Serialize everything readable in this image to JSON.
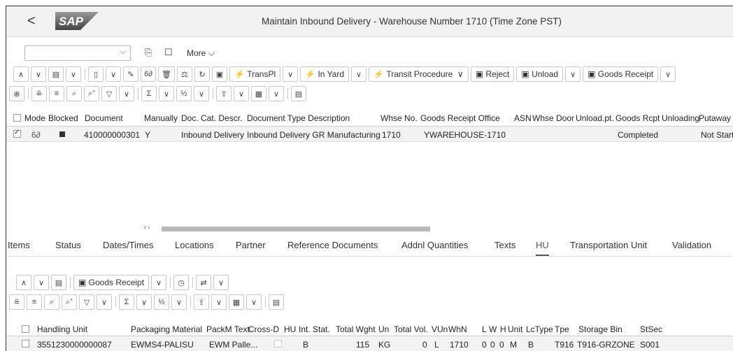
{
  "header": {
    "back_glyph": "<",
    "logo_text": "SAP",
    "title": "Maintain Inbound Delivery - Warehouse Number 1710 (Time Zone PST)"
  },
  "toolbar": {
    "command_value": "",
    "more_label": "More",
    "buttons": {
      "transpl": "TransPl",
      "in_yard": "In Yard",
      "transit_procedure": "Transit Procedure",
      "reject": "Reject",
      "unload": "Unload",
      "goods_receipt": "Goods Receipt"
    }
  },
  "top_grid": {
    "columns": [
      "Mode",
      "Blocked",
      "Document",
      "Manually",
      "Doc. Cat. Descr.",
      "Document Type Description",
      "Whse No.",
      "Goods Receipt Office",
      "ASN",
      "Whse Door",
      "Unload.pt.",
      "Goods Rcpt",
      "Unloading",
      "Putaway"
    ],
    "row": {
      "mode": "6∂",
      "document": "410000000301",
      "manually": "Y",
      "doc_cat": "Inbound Delivery",
      "doc_type": "Inbound Delivery GR Manufacturing",
      "whse_no": "1710",
      "gr_office": "YWAREHOUSE-1710",
      "goods_rcpt": "Completed",
      "putaway": "Not Start"
    }
  },
  "tabs": [
    "Items",
    "Status",
    "Dates/Times",
    "Locations",
    "Partner",
    "Reference Documents",
    "Addnl Quantities",
    "Texts",
    "HU",
    "Transportation Unit",
    "Validation"
  ],
  "hu_toolbar": {
    "goods_receipt": "Goods Receipt"
  },
  "hu_grid": {
    "columns": [
      "Handling Unit",
      "Packaging Material",
      "PackM Text",
      "Cross-D",
      "HU",
      "Int. Stat.",
      "Total Wght",
      "Un",
      "Total Vol.",
      "VUn",
      "WhN",
      "L",
      "W",
      "H",
      "Unit",
      "LcType",
      "Tpe",
      "Storage Bin",
      "StSec"
    ],
    "row": {
      "hu": "3551230000000087",
      "pack_mat": "EWMS4-PALISU",
      "packm_text": "EWM Palle...",
      "int_stat": "B",
      "total_wght": "115",
      "un": "KG",
      "total_vol": "0",
      "vun": "L",
      "whn": "1710",
      "l": "0",
      "w": "0",
      "h": "0",
      "unit": "M",
      "lctype": "B",
      "tpe": "T916",
      "storage_bin": "T916-GRZONE",
      "stsec": "S001"
    }
  }
}
